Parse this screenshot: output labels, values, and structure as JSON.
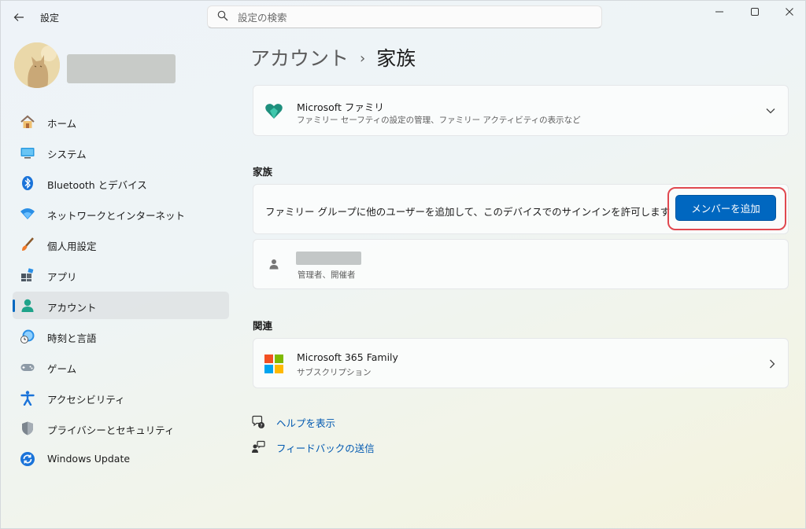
{
  "app": {
    "title": "設定"
  },
  "search": {
    "placeholder": "設定の検索"
  },
  "sidebar": {
    "items": [
      {
        "label": "ホーム",
        "icon": "home-icon"
      },
      {
        "label": "システム",
        "icon": "system-icon"
      },
      {
        "label": "Bluetooth とデバイス",
        "icon": "bluetooth-icon"
      },
      {
        "label": "ネットワークとインターネット",
        "icon": "network-icon"
      },
      {
        "label": "個人用設定",
        "icon": "personalization-icon"
      },
      {
        "label": "アプリ",
        "icon": "apps-icon"
      },
      {
        "label": "アカウント",
        "icon": "account-icon",
        "active": true
      },
      {
        "label": "時刻と言語",
        "icon": "time-language-icon"
      },
      {
        "label": "ゲーム",
        "icon": "gaming-icon"
      },
      {
        "label": "アクセシビリティ",
        "icon": "accessibility-icon"
      },
      {
        "label": "プライバシーとセキュリティ",
        "icon": "privacy-shield-icon"
      },
      {
        "label": "Windows Update",
        "icon": "windows-update-icon"
      }
    ]
  },
  "breadcrumb": {
    "parent": "アカウント",
    "separator": "›",
    "current": "家族"
  },
  "family_card": {
    "title": "Microsoft ファミリ",
    "subtitle": "ファミリー セーフティの設定の管理、ファミリー アクティビティの表示など"
  },
  "family_section": {
    "heading": "家族",
    "add_text": "ファミリー グループに他のユーザーを追加して、このデバイスでのサインインを許可します",
    "add_button": "メンバーを追加",
    "member_role": "管理者、開催者"
  },
  "related_section": {
    "heading": "関連",
    "m365_title": "Microsoft 365 Family",
    "m365_sub": "サブスクリプション"
  },
  "links": {
    "help": "ヘルプを表示",
    "feedback": "フィードバックの送信"
  },
  "colors": {
    "accent": "#0067c0",
    "highlight": "#e0484f"
  }
}
